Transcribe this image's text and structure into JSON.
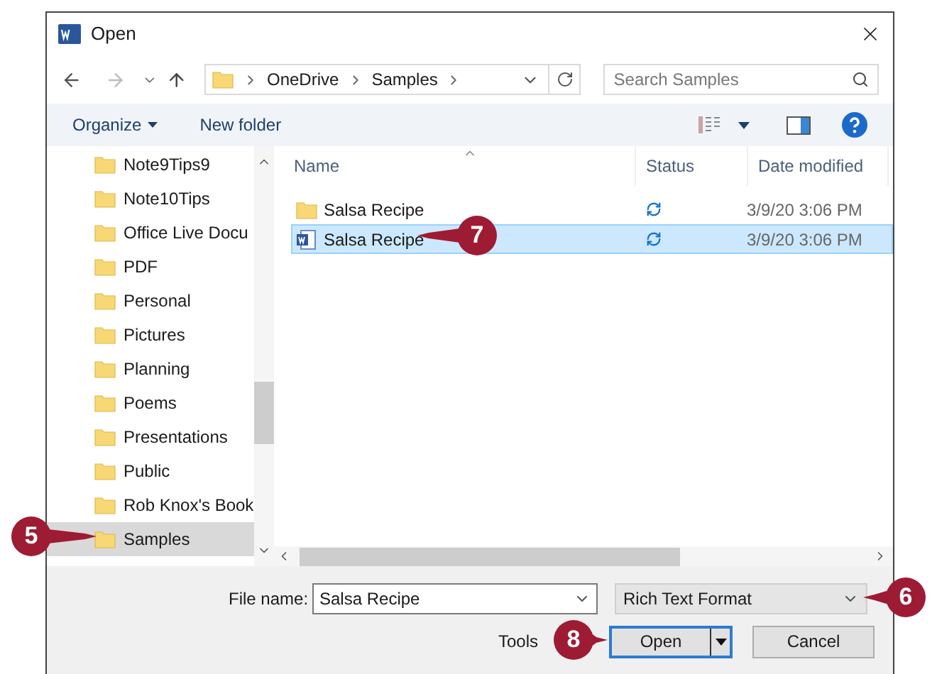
{
  "window": {
    "title": "Open"
  },
  "nav": {
    "path": [
      "OneDrive",
      "Samples"
    ],
    "search_placeholder": "Search Samples"
  },
  "toolbar": {
    "organize": "Organize",
    "new_folder": "New folder"
  },
  "sidebar": {
    "items": [
      {
        "label": "Note9Tips9",
        "selected": false
      },
      {
        "label": "Note10Tips",
        "selected": false
      },
      {
        "label": "Office Live Docu",
        "selected": false
      },
      {
        "label": "PDF",
        "selected": false
      },
      {
        "label": "Personal",
        "selected": false
      },
      {
        "label": "Pictures",
        "selected": false
      },
      {
        "label": "Planning",
        "selected": false
      },
      {
        "label": "Poems",
        "selected": false
      },
      {
        "label": "Presentations",
        "selected": false
      },
      {
        "label": "Public",
        "selected": false
      },
      {
        "label": "Rob Knox's Book",
        "selected": false
      },
      {
        "label": "Samples",
        "selected": true
      }
    ]
  },
  "columns": [
    "Name",
    "Status",
    "Date modified"
  ],
  "files": [
    {
      "name": "Salsa Recipe",
      "kind": "folder",
      "date": "3/9/20 3:06 PM",
      "selected": false
    },
    {
      "name": "Salsa Recipe",
      "kind": "document",
      "date": "3/9/20 3:06 PM",
      "selected": true
    }
  ],
  "footer": {
    "file_name_label": "File name:",
    "file_name": "Salsa Recipe",
    "file_type": "Rich Text Format",
    "tools": "Tools",
    "open": "Open",
    "cancel": "Cancel"
  },
  "callouts": [
    {
      "number": "5"
    },
    {
      "number": "7"
    },
    {
      "number": "6"
    },
    {
      "number": "8"
    }
  ]
}
